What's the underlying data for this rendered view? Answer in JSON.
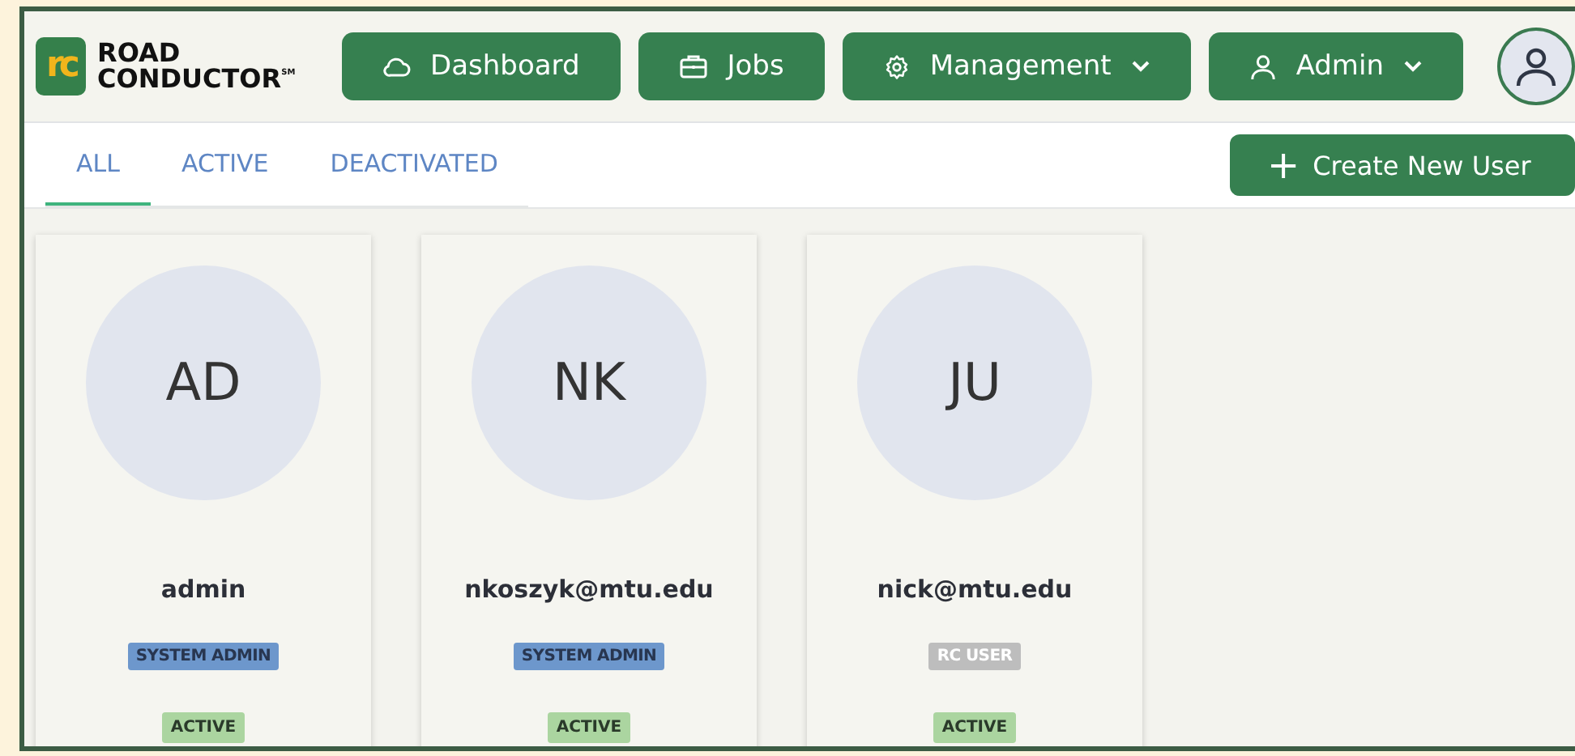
{
  "logo": {
    "mark": "rc",
    "line_1": "ROAD",
    "line_2": "CONDUCTOR",
    "trademark": "SM"
  },
  "nav": [
    {
      "label": "Dashboard",
      "kind": "dashboard",
      "dropdown": false
    },
    {
      "label": "Jobs",
      "kind": "jobs",
      "dropdown": false
    },
    {
      "label": "Management",
      "kind": "management",
      "dropdown": true
    },
    {
      "label": "Admin",
      "kind": "account",
      "dropdown": true
    }
  ],
  "tabs": [
    {
      "label": "ALL",
      "selected": true
    },
    {
      "label": "ACTIVE",
      "selected": false
    },
    {
      "label": "DEACTIVATED",
      "selected": false
    }
  ],
  "create_button": {
    "icon": "+",
    "label": "Create New User"
  },
  "users": [
    {
      "initials": "AD",
      "name": "admin",
      "role": {
        "label": "SYSTEM ADMIN",
        "kind": "admin"
      },
      "status": "ACTIVE"
    },
    {
      "initials": "NK",
      "name": "nkoszyk@mtu.edu",
      "role": {
        "label": "SYSTEM ADMIN",
        "kind": "admin"
      },
      "status": "ACTIVE"
    },
    {
      "initials": "JU",
      "name": "nick@mtu.edu",
      "role": {
        "label": "RC USER",
        "kind": "user"
      },
      "status": "ACTIVE"
    }
  ]
}
